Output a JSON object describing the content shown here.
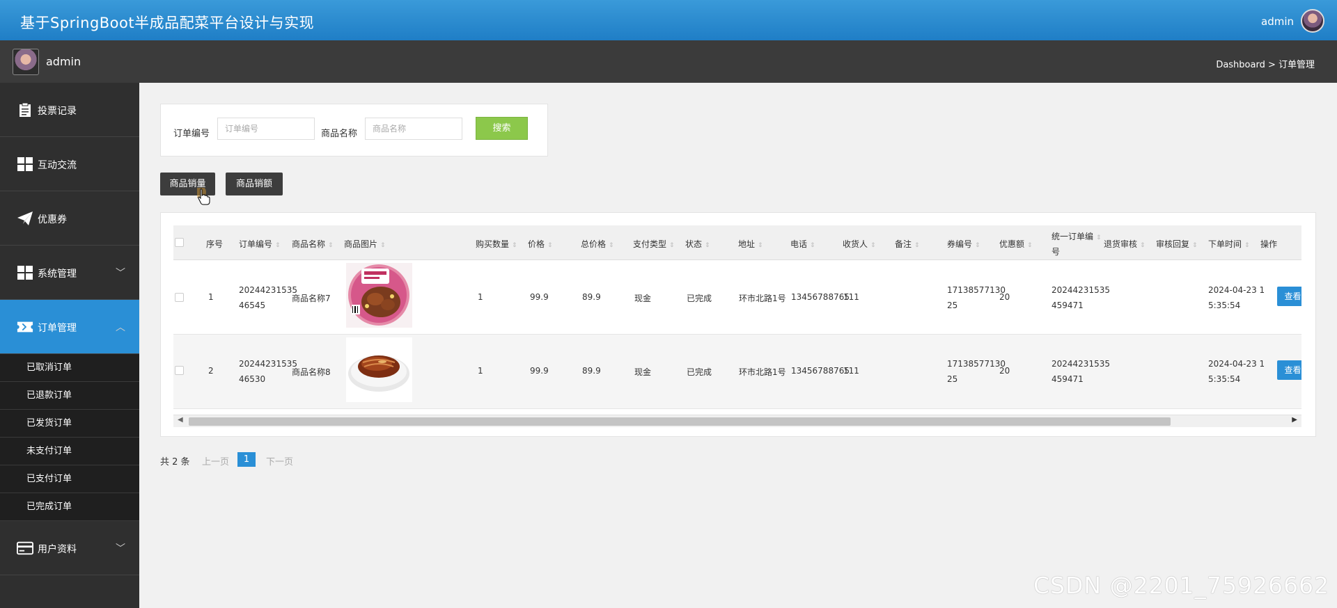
{
  "app": {
    "title": "基于SpringBoot半成品配菜平台设计与实现",
    "top_user": "admin"
  },
  "subbar": {
    "username": "admin",
    "breadcrumb": "Dashboard > 订单管理"
  },
  "sidebar": {
    "items": [
      {
        "label": "投票记录",
        "icon": "clipboard-icon"
      },
      {
        "label": "互动交流",
        "icon": "grid-icon"
      },
      {
        "label": "优惠券",
        "icon": "paper-plane-icon"
      },
      {
        "label": "系统管理",
        "icon": "grid-icon",
        "chevron": "﹀"
      },
      {
        "label": "订单管理",
        "icon": "ticket-icon",
        "chevron": "︿"
      }
    ],
    "sub_items": [
      "已取消订单",
      "已退款订单",
      "已发货订单",
      "未支付订单",
      "已支付订单",
      "已完成订单"
    ],
    "last_item": {
      "label": "用户资料",
      "icon": "card-icon",
      "chevron": "﹀"
    }
  },
  "search": {
    "order_no_label": "订单编号",
    "order_no_placeholder": "订单编号",
    "product_label": "商品名称",
    "product_placeholder": "商品名称",
    "button": "搜索"
  },
  "actions": {
    "sales_volume": "商品销量",
    "sales_amount": "商品销额"
  },
  "table": {
    "headers": [
      "序号",
      "订单编号",
      "商品名称",
      "商品图片",
      "购买数量",
      "价格",
      "总价格",
      "支付类型",
      "状态",
      "地址",
      "电话",
      "收货人",
      "备注",
      "券编号",
      "优惠额",
      "统一订单编",
      "号",
      "退货审核",
      "审核回复",
      "下单时间",
      "操作"
    ],
    "rows": [
      {
        "seq": "1",
        "order_no_1": "20244231535",
        "order_no_2": "46545",
        "product": "商品名称7",
        "qty": "1",
        "price": "99.9",
        "total": "89.9",
        "pay": "现金",
        "status": "已完成",
        "address": "环市北路1号",
        "phone": "13456788765",
        "receiver": "111",
        "coupon_1": "17138577130",
        "coupon_2": "25",
        "discount": "20",
        "unified_1": "20244231535",
        "unified_2": "459471",
        "time_1": "2024-04-23 1",
        "time_2": "5:35:54",
        "view": "查看"
      },
      {
        "seq": "2",
        "order_no_1": "20244231535",
        "order_no_2": "46530",
        "product": "商品名称8",
        "qty": "1",
        "price": "99.9",
        "total": "89.9",
        "pay": "现金",
        "status": "已完成",
        "address": "环市北路1号",
        "phone": "13456788765",
        "receiver": "111",
        "coupon_1": "17138577130",
        "coupon_2": "25",
        "discount": "20",
        "unified_1": "20244231535",
        "unified_2": "459471",
        "time_1": "2024-04-23 1",
        "time_2": "5:35:54",
        "view": "查看"
      }
    ]
  },
  "pager": {
    "total": "共 2 条",
    "prev": "上一页",
    "page": "1",
    "next": "下一页"
  },
  "watermark": "CSDN @2201_75926662",
  "colors": {
    "primary": "#2a8fd6",
    "search_button": "#8cc84b",
    "sidebar": "#2f2f2f",
    "dark_button": "#3d3d3d"
  }
}
